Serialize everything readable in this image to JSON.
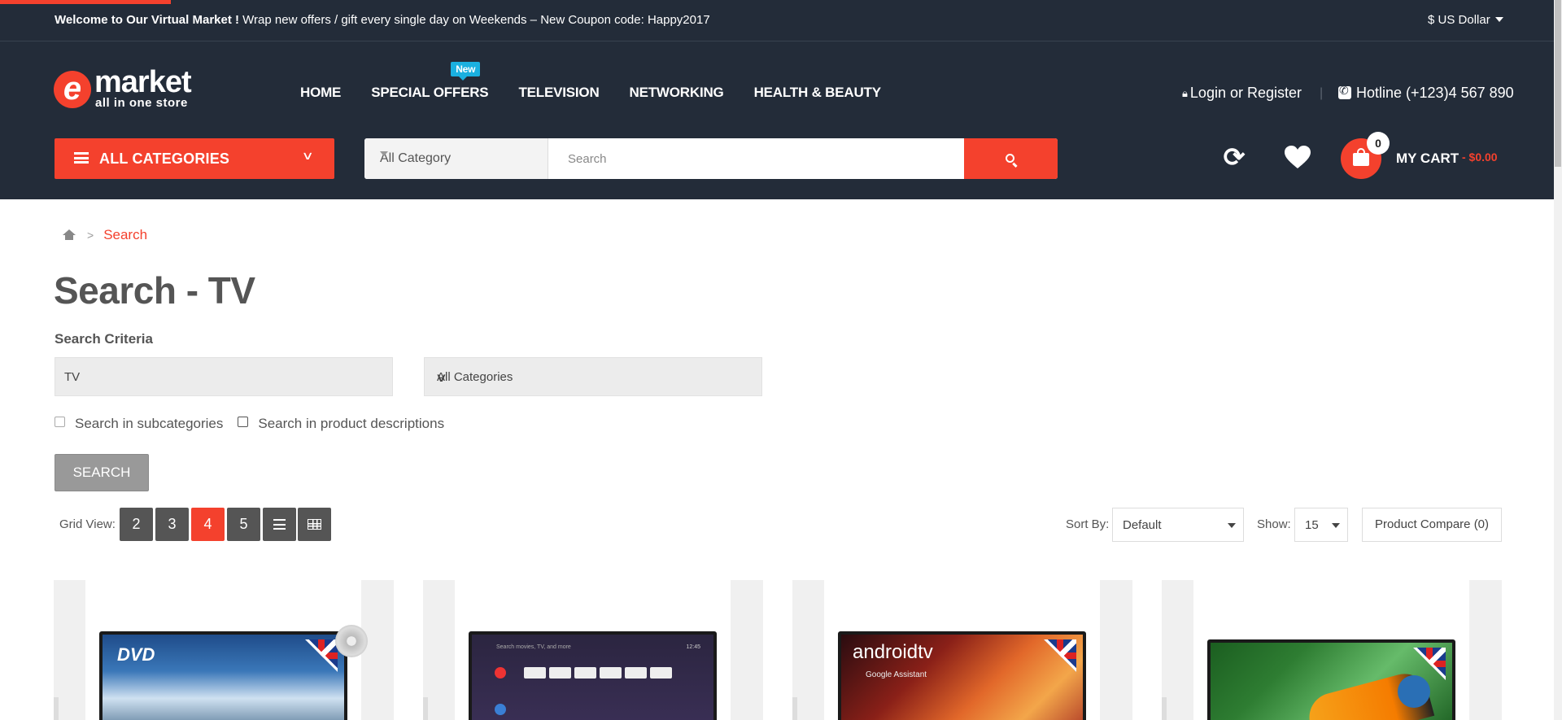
{
  "topbar": {
    "welcome_bold": "Welcome to Our Virtual Market !",
    "welcome_rest": " Wrap new offers / gift every single day on Weekends – New Coupon code: Happy2017",
    "currency": "$ US Dollar"
  },
  "logo": {
    "mark": "e",
    "word": "market",
    "tagline": "all in one store"
  },
  "nav": {
    "items": [
      "HOME",
      "SPECIAL OFFERS",
      "TELEVISION",
      "NETWORKING",
      "HEALTH & BEAUTY"
    ],
    "badge": "New"
  },
  "account": {
    "login": "Login or Register",
    "separator": "|",
    "hotline": "Hotline (+123)4 567 890"
  },
  "categories_button": "ALL CATEGORIES",
  "search": {
    "category": "All Category",
    "placeholder": "Search"
  },
  "cart": {
    "count": "0",
    "label": "MY CART",
    "total": "- $0.00"
  },
  "breadcrumb": {
    "current": "Search",
    "separator": ">"
  },
  "page_title": "Search - TV",
  "criteria": {
    "heading": "Search Criteria",
    "keyword": "TV",
    "category": "All Categories",
    "subcategories_label": "Search in subcategories",
    "descriptions_label": "Search in product descriptions",
    "button": "SEARCH"
  },
  "toolbar": {
    "grid_label": "Grid View:",
    "grid_options": [
      "2",
      "3",
      "4",
      "5"
    ],
    "active_grid": "4",
    "sort_label": "Sort By:",
    "sort_value": "Default",
    "show_label": "Show:",
    "show_value": "15",
    "compare": "Product Compare (0)"
  },
  "products": [
    {
      "screen_text": "DVD"
    },
    {
      "screen_text": "Search movies, TV, and more",
      "time": "12:45"
    },
    {
      "screen_text": "androidtv",
      "sub": "Google Assistant"
    },
    {
      "screen_text": ""
    }
  ],
  "colors": {
    "accent": "#f4412d",
    "header_bg": "#232c39",
    "badge": "#1ab0e0"
  }
}
